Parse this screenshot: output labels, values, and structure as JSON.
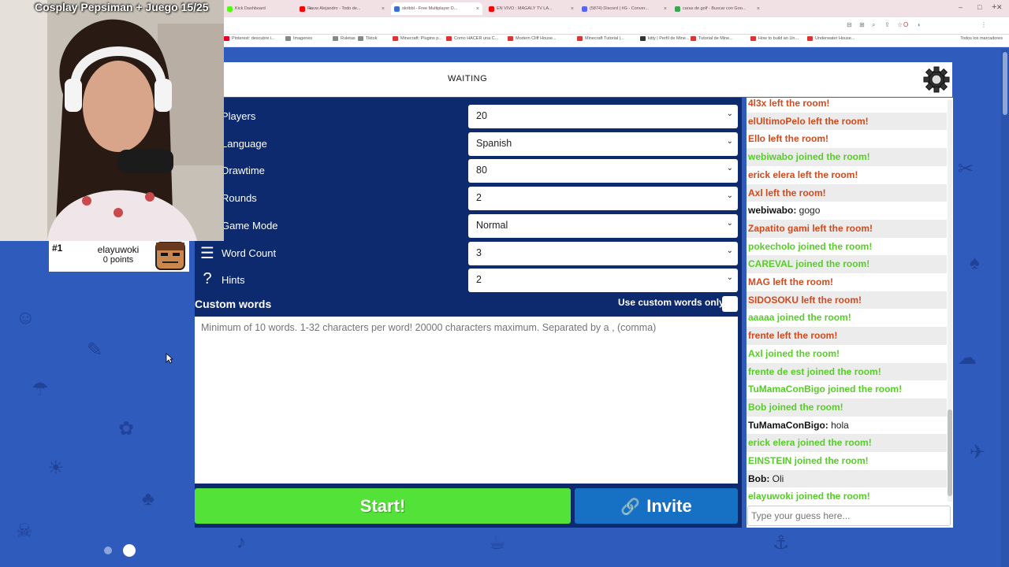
{
  "stream": {
    "title": "Cosplay Pepsiman + Juego 15/25"
  },
  "browser": {
    "tabs": [
      {
        "label": "Kick Dashboard",
        "color": "#53fc18"
      },
      {
        "label": "Rauw Alejandro - Todo de...",
        "color": "#ff0000"
      },
      {
        "label": "skribbl - Free Multiplayer D...",
        "color": "#3a6ed6"
      },
      {
        "label": "EN VIVO : MAGALY TV LA...",
        "color": "#ff0000"
      },
      {
        "label": "(5874) Discord | #G - Conver...",
        "color": "#5865f2"
      },
      {
        "label": "caras de golf - Buscar con Goo...",
        "color": "#34a853"
      }
    ],
    "bookmarks": [
      "Pinterest: descubre i...",
      "Imagenes",
      "Ruletas",
      "Tiktok",
      "Minecraft: Plugins p...",
      "Como HACER una C...",
      "Modern Cliff House...",
      "Minecraft Tutorial |...",
      "kitty | Perfil de Mine...",
      "Tutorial de Mine...",
      "How to build an Un...",
      "Underwater House..."
    ],
    "bookmarks_end": "Todos los marcadores"
  },
  "header": {
    "status": "WAITING",
    "settings_icon": "gear-icon"
  },
  "settings": {
    "rows": [
      {
        "label": "Players",
        "value": "20",
        "icon": "person-icon"
      },
      {
        "label": "Language",
        "value": "Spanish",
        "icon": "globe-icon"
      },
      {
        "label": "Drawtime",
        "value": "80",
        "icon": "clock-icon"
      },
      {
        "label": "Rounds",
        "value": "2",
        "icon": "refresh-icon"
      },
      {
        "label": "Game Mode",
        "value": "Normal",
        "icon": "controller-icon"
      },
      {
        "label": "Word Count",
        "value": "3",
        "icon": "lines-icon"
      },
      {
        "label": "Hints",
        "value": "2",
        "icon": "question-icon"
      }
    ],
    "custom_words_title": "Custom words",
    "use_custom_words_label": "Use custom words only",
    "custom_words_placeholder": "Minimum of 10 words. 1-32 characters per word! 20000 characters maximum. Separated by a , (comma)",
    "start_label": "Start!",
    "invite_label": "Invite"
  },
  "players": [
    {
      "rank": "#1",
      "name": "elayuwoki",
      "points": "0 points"
    }
  ],
  "chat": {
    "messages": [
      {
        "type": "red",
        "text": "4l3x left the room!"
      },
      {
        "type": "red",
        "text": "elUltimoPelo left the room!"
      },
      {
        "type": "red",
        "text": "Ello left the room!"
      },
      {
        "type": "green",
        "text": "webiwabo joined the room!"
      },
      {
        "type": "red",
        "text": "erick elera left the room!"
      },
      {
        "type": "red",
        "text": "Axl left the room!"
      },
      {
        "type": "chat",
        "who": "webiwabo:",
        "text": " gogo"
      },
      {
        "type": "red",
        "text": "Zapatito gami left the room!"
      },
      {
        "type": "green",
        "text": "pokecholo joined the room!"
      },
      {
        "type": "green",
        "text": "CAREVAL joined the room!"
      },
      {
        "type": "red",
        "text": "MAG left the room!"
      },
      {
        "type": "red",
        "text": "SIDOSOKU left the room!"
      },
      {
        "type": "green",
        "text": "aaaaa joined the room!"
      },
      {
        "type": "red",
        "text": "frente left the room!"
      },
      {
        "type": "green",
        "text": "Axl joined the room!"
      },
      {
        "type": "green",
        "text": "frente de est joined the room!"
      },
      {
        "type": "green",
        "text": "TuMamaConBigo joined the room!"
      },
      {
        "type": "green",
        "text": "Bob joined the room!"
      },
      {
        "type": "chat",
        "who": "TuMamaConBigo:",
        "text": " hola"
      },
      {
        "type": "green",
        "text": "erick elera joined the room!"
      },
      {
        "type": "green",
        "text": "EINSTEIN joined the room!"
      },
      {
        "type": "chat",
        "who": "Bob:",
        "text": " Oli"
      },
      {
        "type": "green",
        "text": "elayuwoki joined the room!"
      }
    ],
    "guess_placeholder": "Type your guess here..."
  },
  "colors": {
    "start": "#53e237",
    "invite": "#1671c5",
    "left": "#d04a1e",
    "joined": "#56ce27",
    "background": "#2f5bbd"
  }
}
